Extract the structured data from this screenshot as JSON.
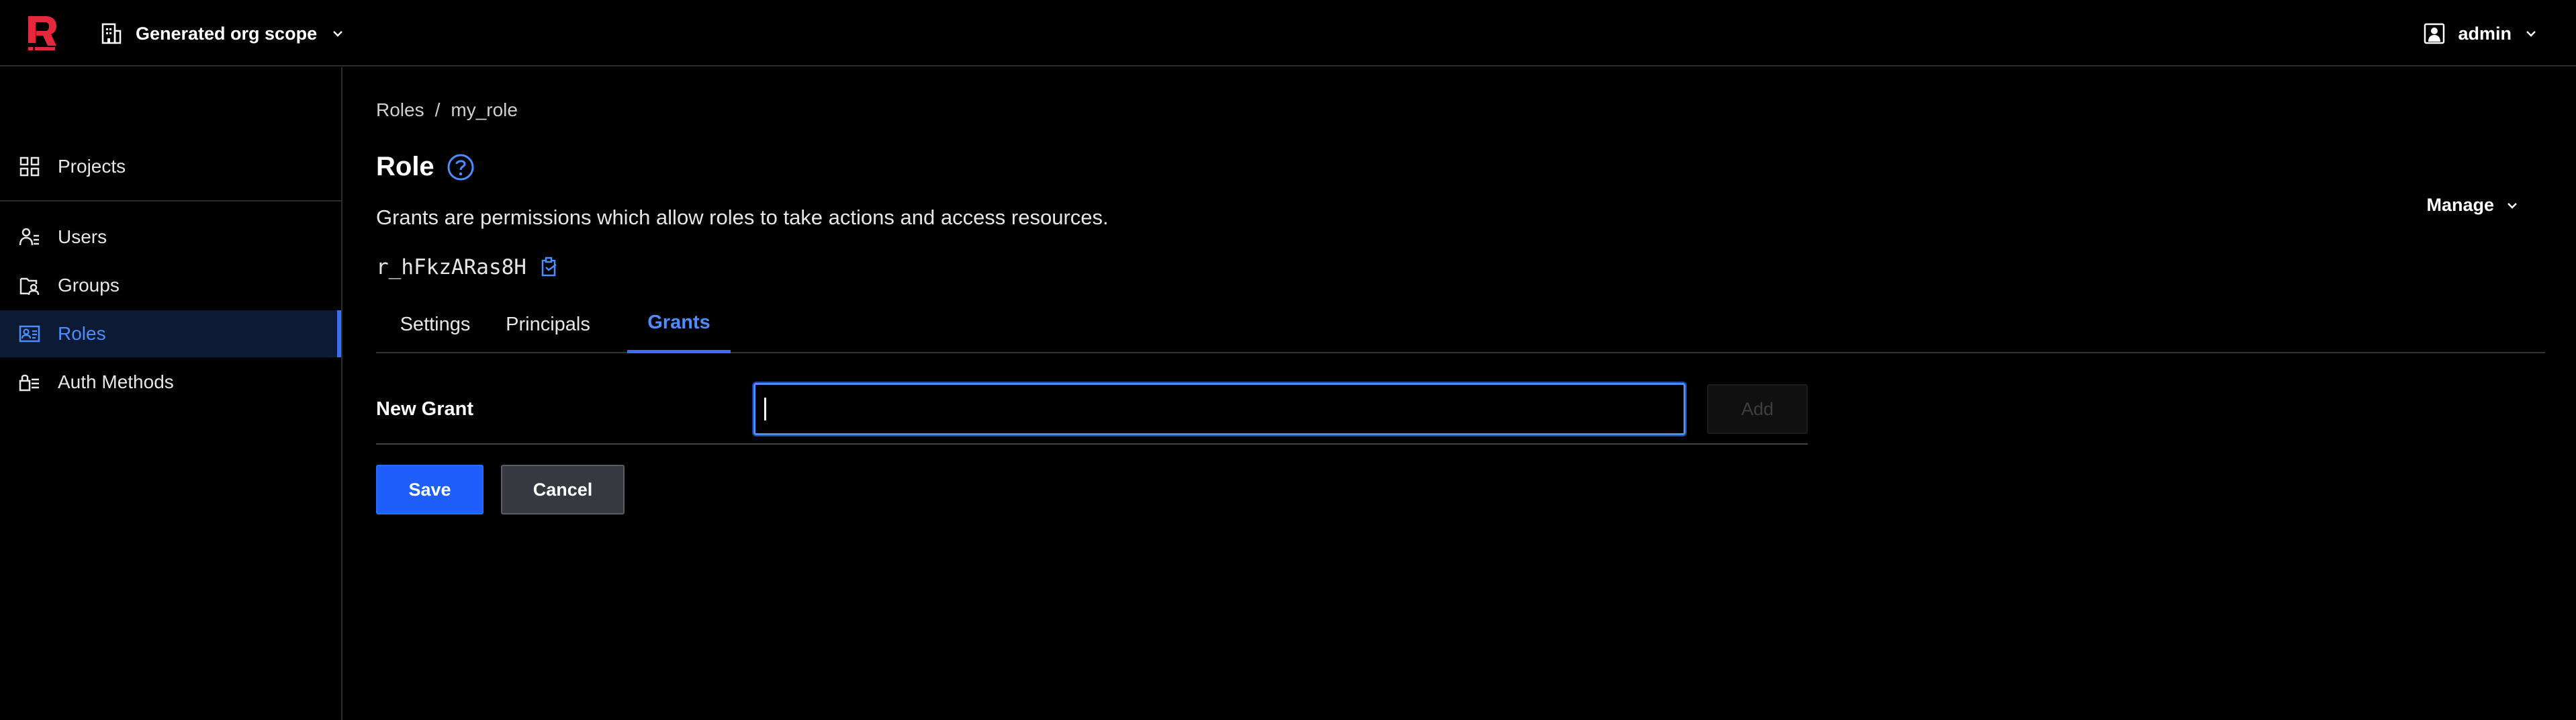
{
  "header": {
    "scope_label": "Generated org scope",
    "user_label": "admin"
  },
  "sidebar": {
    "items": [
      {
        "label": "Projects",
        "icon": "grid-icon"
      },
      {
        "label": "Users",
        "icon": "users-icon"
      },
      {
        "label": "Groups",
        "icon": "groups-icon"
      },
      {
        "label": "Roles",
        "icon": "id-card-icon",
        "active": true
      },
      {
        "label": "Auth Methods",
        "icon": "auth-methods-icon"
      }
    ]
  },
  "breadcrumb": {
    "root": "Roles",
    "separator": "/",
    "current": "my_role"
  },
  "page": {
    "title": "Role",
    "description": "Grants are permissions which allow roles to take actions and access resources.",
    "resource_id": "r_hFkzARas8H",
    "manage_label": "Manage"
  },
  "tabs": [
    {
      "label": "Settings"
    },
    {
      "label": "Principals"
    },
    {
      "label": "Grants",
      "active": true
    }
  ],
  "grant_form": {
    "label": "New Grant",
    "value": "",
    "add_label": "Add",
    "save_label": "Save",
    "cancel_label": "Cancel"
  },
  "colors": {
    "accent": "#3b6ef5",
    "active_text": "#4d8dff",
    "background": "#000000",
    "save_button": "#1f5efb",
    "brand_logo": "#e3293b"
  }
}
